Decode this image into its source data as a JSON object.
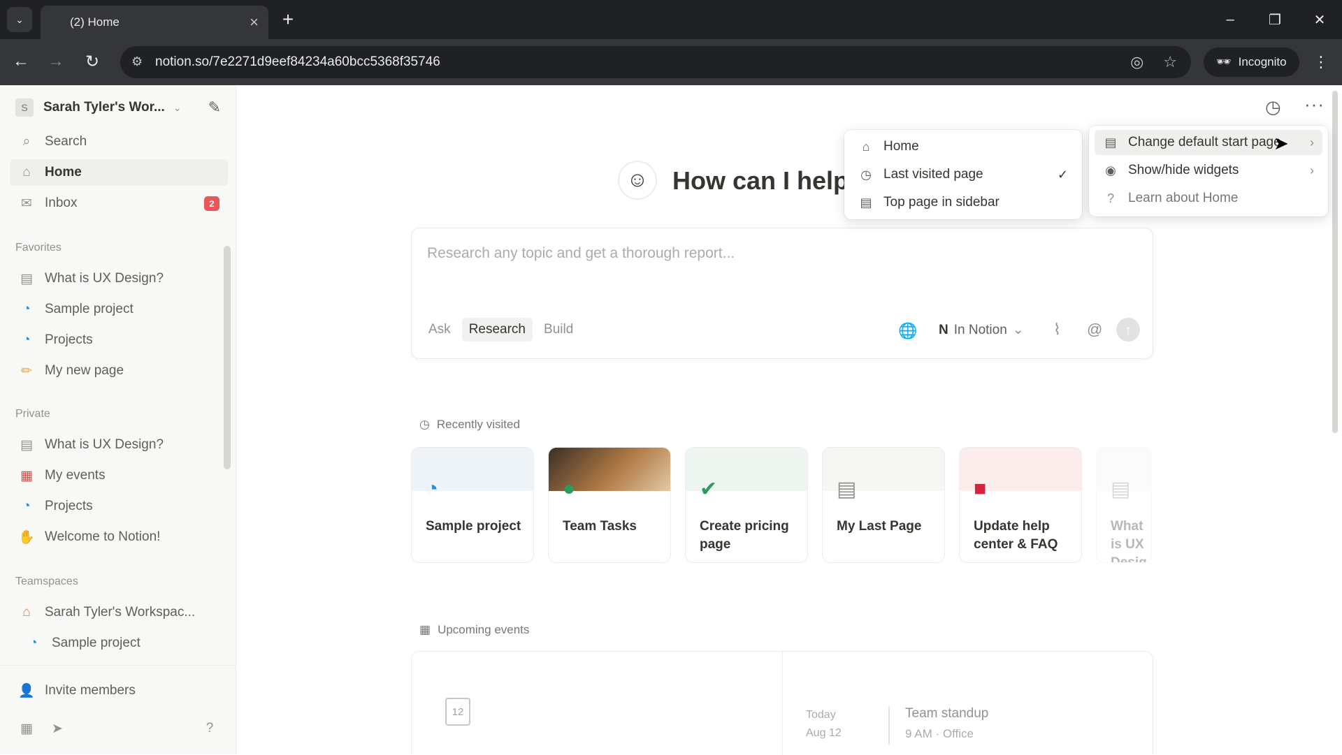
{
  "browser": {
    "tab_title": "(2) Home",
    "url": "notion.so/7e2271d9eef84234a60bcc5368f35746",
    "incognito_label": "Incognito"
  },
  "sidebar": {
    "workspace_initial": "S",
    "workspace_name": "Sarah Tyler's Wor...",
    "top_items": [
      {
        "label": "Search",
        "icon": "search-icon"
      },
      {
        "label": "Home",
        "icon": "home-icon"
      },
      {
        "label": "Inbox",
        "icon": "inbox-icon",
        "badge": "2"
      }
    ],
    "favorites_label": "Favorites",
    "favorites": [
      {
        "label": "What is UX Design?",
        "icon": "page-icon"
      },
      {
        "label": "Sample project",
        "icon": "project-icon"
      },
      {
        "label": "Projects",
        "icon": "project-icon"
      },
      {
        "label": "My new page",
        "icon": "pencil-icon"
      }
    ],
    "private_label": "Private",
    "private": [
      {
        "label": "What is UX Design?",
        "icon": "page-icon"
      },
      {
        "label": "My events",
        "icon": "calendar-icon"
      },
      {
        "label": "Projects",
        "icon": "project-icon"
      },
      {
        "label": "Welcome to Notion!",
        "icon": "wave-icon"
      }
    ],
    "teamspaces_label": "Teamspaces",
    "teamspaces": [
      {
        "label": "Sarah Tyler's Workspac...",
        "icon": "house-icon"
      },
      {
        "label": "Sample project",
        "icon": "project-icon"
      }
    ],
    "invite_label": "Invite members"
  },
  "main": {
    "hero_title": "How can I help y",
    "ai": {
      "placeholder": "Research any topic and get a thorough report...",
      "modes": [
        "Ask",
        "Research",
        "Build"
      ],
      "active_mode": "Research",
      "source_label": "In Notion"
    },
    "recently_visited_label": "Recently visited",
    "recent_cards": [
      {
        "title": "Sample project",
        "band": "#eef3f7"
      },
      {
        "title": "Team Tasks",
        "band": "#8a6a4e"
      },
      {
        "title": "Create pricing page",
        "band": "#eff5f1"
      },
      {
        "title": "My Last Page",
        "band": "#f6f6f5"
      },
      {
        "title": "Update help center & FAQ",
        "band": "#fdecec"
      },
      {
        "title": "What is UX Desig",
        "band": "#f6f6f5"
      }
    ],
    "upcoming_label": "Upcoming events",
    "calendar_day": "12",
    "event": {
      "day": "Today",
      "date": "Aug 12",
      "title": "Team standup",
      "meta": "9 AM · Office"
    }
  },
  "start_page_menu": {
    "items": [
      {
        "label": "Home",
        "icon": "home-icon",
        "checked": false
      },
      {
        "label": "Last visited page",
        "icon": "history-icon",
        "checked": true
      },
      {
        "label": "Top page in sidebar",
        "icon": "page-icon",
        "checked": false
      }
    ]
  },
  "options_menu": {
    "items": [
      {
        "label": "Change default start page",
        "icon": "page-icon",
        "submenu": true
      },
      {
        "label": "Show/hide widgets",
        "icon": "eye-icon",
        "submenu": true
      },
      {
        "label": "Learn about Home",
        "icon": "help-icon",
        "submenu": false
      }
    ]
  },
  "colors": {
    "accent": "#2383e2",
    "badge": "#eb5757",
    "check_green": "#2a9d5c",
    "book_red": "#d8213b"
  }
}
